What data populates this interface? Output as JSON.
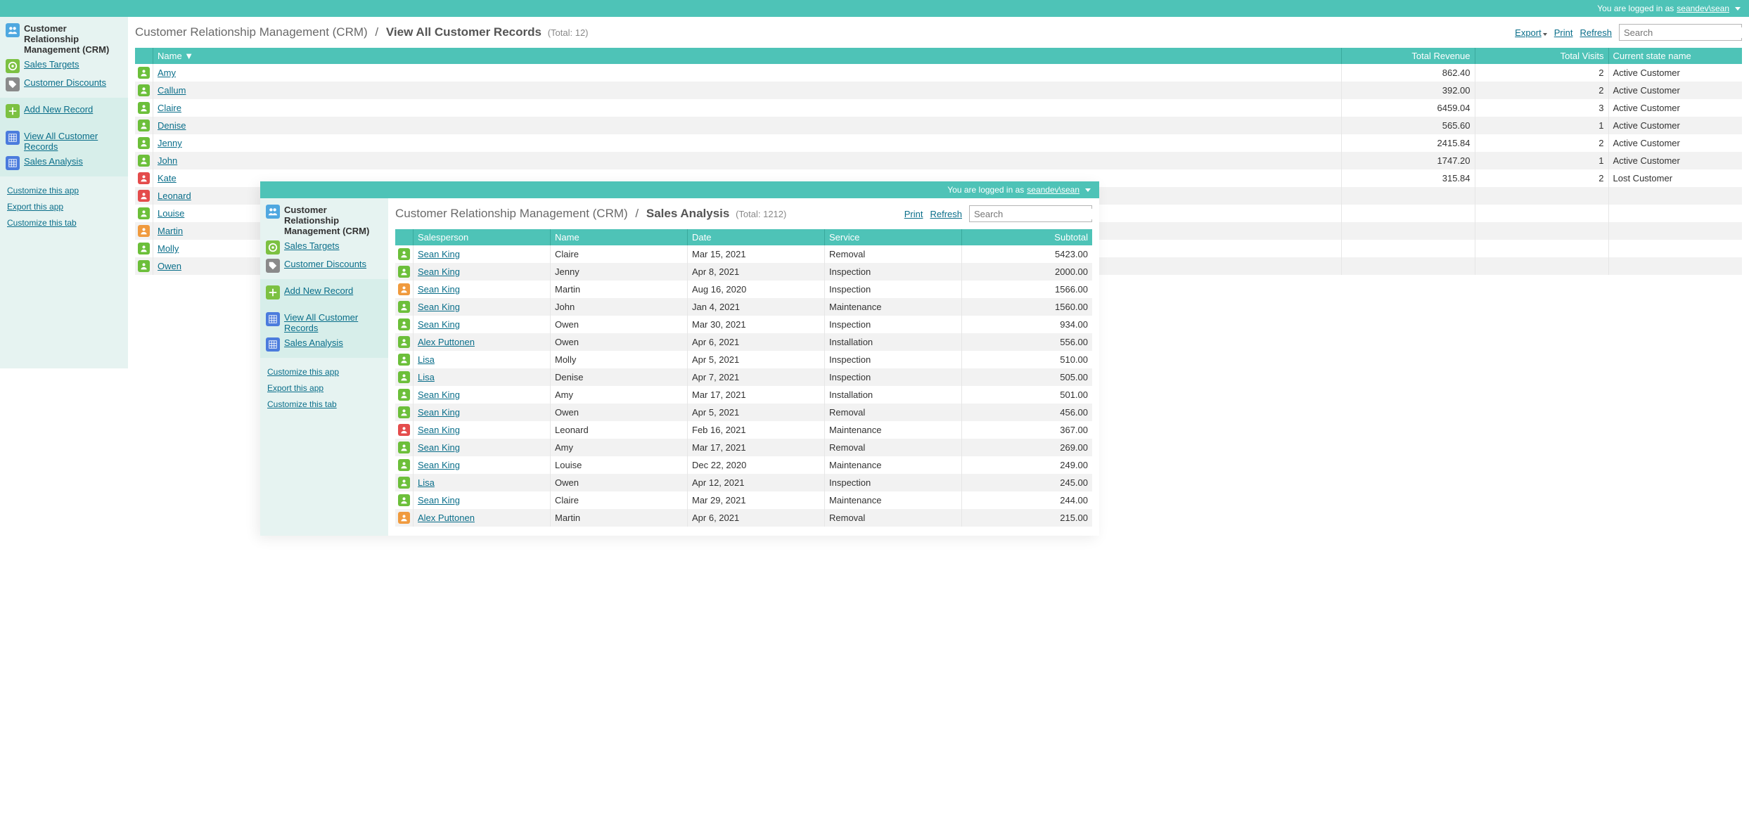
{
  "topbar": {
    "logged_in_text": "You are logged in as",
    "user": "seandev\\sean"
  },
  "sidebar": {
    "title": "Customer Relationship Management (CRM)",
    "sales_targets": "Sales Targets",
    "customer_discounts": "Customer Discounts",
    "add_new_record": "Add New Record",
    "view_all": "View All Customer Records",
    "sales_analysis": "Sales Analysis",
    "customize_app": "Customize this app",
    "export_app": "Export this app",
    "customize_tab": "Customize this tab"
  },
  "win1": {
    "breadcrumb_root": "Customer Relationship Management (CRM)",
    "breadcrumb_current": "View All Customer Records",
    "total_label": "(Total: 12)",
    "actions": {
      "export": "Export",
      "print": "Print",
      "refresh": "Refresh"
    },
    "search_placeholder": "Search",
    "columns": {
      "name": "Name ▼",
      "revenue": "Total Revenue",
      "visits": "Total Visits",
      "state": "Current state name"
    },
    "rows": [
      {
        "name": "Amy",
        "revenue": "862.40",
        "visits": "2",
        "state": "Active Customer",
        "ic": "green"
      },
      {
        "name": "Callum",
        "revenue": "392.00",
        "visits": "2",
        "state": "Active Customer",
        "ic": "green"
      },
      {
        "name": "Claire",
        "revenue": "6459.04",
        "visits": "3",
        "state": "Active Customer",
        "ic": "green"
      },
      {
        "name": "Denise",
        "revenue": "565.60",
        "visits": "1",
        "state": "Active Customer",
        "ic": "green"
      },
      {
        "name": "Jenny",
        "revenue": "2415.84",
        "visits": "2",
        "state": "Active Customer",
        "ic": "green"
      },
      {
        "name": "John",
        "revenue": "1747.20",
        "visits": "1",
        "state": "Active Customer",
        "ic": "green"
      },
      {
        "name": "Kate",
        "revenue": "315.84",
        "visits": "2",
        "state": "Lost Customer",
        "ic": "red"
      },
      {
        "name": "Leonard",
        "revenue": "",
        "visits": "",
        "state": "",
        "ic": "red"
      },
      {
        "name": "Louise",
        "revenue": "",
        "visits": "",
        "state": "",
        "ic": "green"
      },
      {
        "name": "Martin",
        "revenue": "",
        "visits": "",
        "state": "",
        "ic": "orange"
      },
      {
        "name": "Molly",
        "revenue": "",
        "visits": "",
        "state": "",
        "ic": "green"
      },
      {
        "name": "Owen",
        "revenue": "",
        "visits": "",
        "state": "",
        "ic": "green"
      }
    ]
  },
  "win2": {
    "breadcrumb_root": "Customer Relationship Management (CRM)",
    "breadcrumb_current": "Sales Analysis",
    "total_label": "(Total: 1212)",
    "actions": {
      "print": "Print",
      "refresh": "Refresh"
    },
    "search_placeholder": "Search",
    "columns": {
      "sp": "Salesperson",
      "name": "Name",
      "date": "Date",
      "service": "Service",
      "subtotal": "Subtotal"
    },
    "rows": [
      {
        "sp": "Sean King",
        "name": "Claire",
        "date": "Mar 15, 2021",
        "service": "Removal",
        "subtotal": "5423.00",
        "ic": "green"
      },
      {
        "sp": "Sean King",
        "name": "Jenny",
        "date": "Apr 8, 2021",
        "service": "Inspection",
        "subtotal": "2000.00",
        "ic": "green"
      },
      {
        "sp": "Sean King",
        "name": "Martin",
        "date": "Aug 16, 2020",
        "service": "Inspection",
        "subtotal": "1566.00",
        "ic": "orange"
      },
      {
        "sp": "Sean King",
        "name": "John",
        "date": "Jan 4, 2021",
        "service": "Maintenance",
        "subtotal": "1560.00",
        "ic": "green"
      },
      {
        "sp": "Sean King",
        "name": "Owen",
        "date": "Mar 30, 2021",
        "service": "Inspection",
        "subtotal": "934.00",
        "ic": "green"
      },
      {
        "sp": "Alex Puttonen",
        "name": "Owen",
        "date": "Apr 6, 2021",
        "service": "Installation",
        "subtotal": "556.00",
        "ic": "green"
      },
      {
        "sp": "Lisa",
        "name": "Molly",
        "date": "Apr 5, 2021",
        "service": "Inspection",
        "subtotal": "510.00",
        "ic": "green"
      },
      {
        "sp": "Lisa",
        "name": "Denise",
        "date": "Apr 7, 2021",
        "service": "Inspection",
        "subtotal": "505.00",
        "ic": "green"
      },
      {
        "sp": "Sean King",
        "name": "Amy",
        "date": "Mar 17, 2021",
        "service": "Installation",
        "subtotal": "501.00",
        "ic": "green"
      },
      {
        "sp": "Sean King",
        "name": "Owen",
        "date": "Apr 5, 2021",
        "service": "Removal",
        "subtotal": "456.00",
        "ic": "green"
      },
      {
        "sp": "Sean King",
        "name": "Leonard",
        "date": "Feb 16, 2021",
        "service": "Maintenance",
        "subtotal": "367.00",
        "ic": "red"
      },
      {
        "sp": "Sean King",
        "name": "Amy",
        "date": "Mar 17, 2021",
        "service": "Removal",
        "subtotal": "269.00",
        "ic": "green"
      },
      {
        "sp": "Sean King",
        "name": "Louise",
        "date": "Dec 22, 2020",
        "service": "Maintenance",
        "subtotal": "249.00",
        "ic": "green"
      },
      {
        "sp": "Lisa",
        "name": "Owen",
        "date": "Apr 12, 2021",
        "service": "Inspection",
        "subtotal": "245.00",
        "ic": "green"
      },
      {
        "sp": "Sean King",
        "name": "Claire",
        "date": "Mar 29, 2021",
        "service": "Maintenance",
        "subtotal": "244.00",
        "ic": "green"
      },
      {
        "sp": "Alex Puttonen",
        "name": "Martin",
        "date": "Apr 6, 2021",
        "service": "Removal",
        "subtotal": "215.00",
        "ic": "orange"
      }
    ]
  }
}
